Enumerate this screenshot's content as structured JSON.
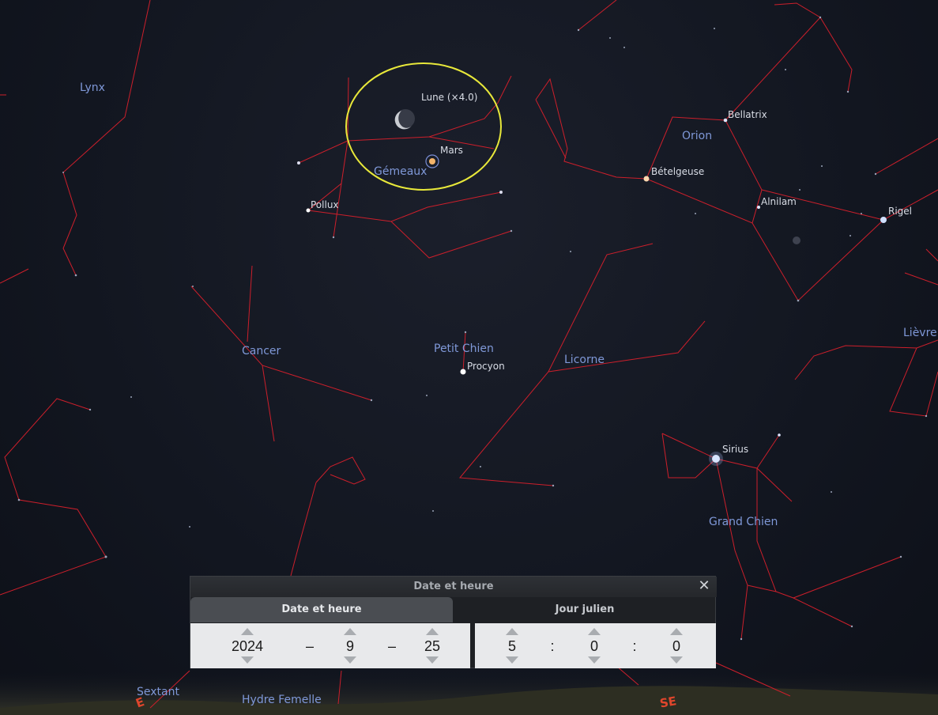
{
  "constellations": [
    "Lynx",
    "Gémeaux",
    "Orion",
    "Cancer",
    "Petit Chien",
    "Licorne",
    "Lièvre",
    "Grand Chien",
    "Sextant",
    "Hydre Femelle"
  ],
  "stars": {
    "pollux": "Pollux",
    "bellatrix": "Bellatrix",
    "betelgeuse": "Bételgeuse",
    "alnilam": "Alnilam",
    "rigel": "Rigel",
    "procyon": "Procyon",
    "sirius": "Sirius"
  },
  "planets": {
    "moon": "Lune (×4.0)",
    "mars": "Mars"
  },
  "cardinals": {
    "east": "E",
    "southeast": "SE"
  },
  "dialog": {
    "title": "Date et heure",
    "close": "✕",
    "tabs": [
      {
        "label": "Date et heure"
      },
      {
        "label": "Jour julien"
      }
    ],
    "date": {
      "year": "2024",
      "month": "9",
      "day": "25",
      "sep1": "–",
      "sep2": "–"
    },
    "time": {
      "hour": "5",
      "minute": "0",
      "second": "0",
      "sep1": ":",
      "sep2": ":"
    }
  },
  "colors": {
    "constellation_line": "#cc1f2b",
    "constellation_label": "#7f98d8",
    "highlight": "#e8e83a",
    "cardinal": "#e0462c"
  }
}
